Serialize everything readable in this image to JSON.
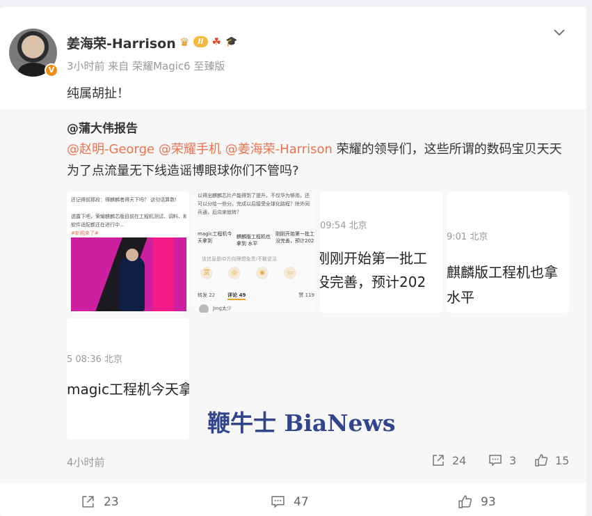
{
  "post": {
    "username": "姜海荣-Harrison",
    "level_badge": "II",
    "meta": "3小时前  来自 荣耀Magic6 至臻版",
    "text": "纯属胡扯！",
    "verified": "V"
  },
  "repost": {
    "author": "@蒲大伟报告",
    "mention1": "@赵明-George",
    "mention2": "@荣耀手机",
    "mention3": "@姜海荣-Harrison",
    "text": " 荣耀的领导们，这些所谓的数码宝贝天天为了点流量无下线造谣博眼球你们不管吗?",
    "time": "4小时前",
    "share_count": "24",
    "comment_count": "3",
    "like_count": "15",
    "thumbs": {
      "t1_lines": [
        "还记得前那段：得麒麟者得天下吗？ 这句话算数!",
        "",
        "透露下吧，荣耀麒麟芯版目前在工程机测试、调料、和",
        "软件适配都还在进行中...",
        "#新机来了#"
      ],
      "t2_lines": [
        "以得出麒麟芯片产能得到了提升。不仅华为够用，还",
        "可以分给一些分。完成以后接受全球化路程？除外同",
        "兵通，后向来就转？"
      ],
      "t2_mini1": "magic工程机今天拿到",
      "t2_mini2": "麒麟版工程机也拿到 水平",
      "t2_mini3": "刚刚开始第一批工 没完善，预计202",
      "t2_footer": "该信息是ID方向理想免责/不敢说法",
      "t2_tab1": "转发 22",
      "t2_tab2": "评论 49",
      "t2_tab3": "赞 119",
      "t2_commenter": "Jing太少",
      "t3_time": "09:54 北京",
      "t3_line1": "刚刚开始第一批工",
      "t3_line2": "没完善，预计202",
      "t4_time": "9:01 北京",
      "t4_line1": "麒麟版工程机也拿",
      "t4_line2": "水平",
      "t5_time": "5 08:36 北京",
      "t5_line1": "magic工程机今天拿到"
    }
  },
  "watermark": "鞭牛士 BiaNews",
  "footer": {
    "share_count": "23",
    "comment_count": "47",
    "like_count": "93"
  }
}
